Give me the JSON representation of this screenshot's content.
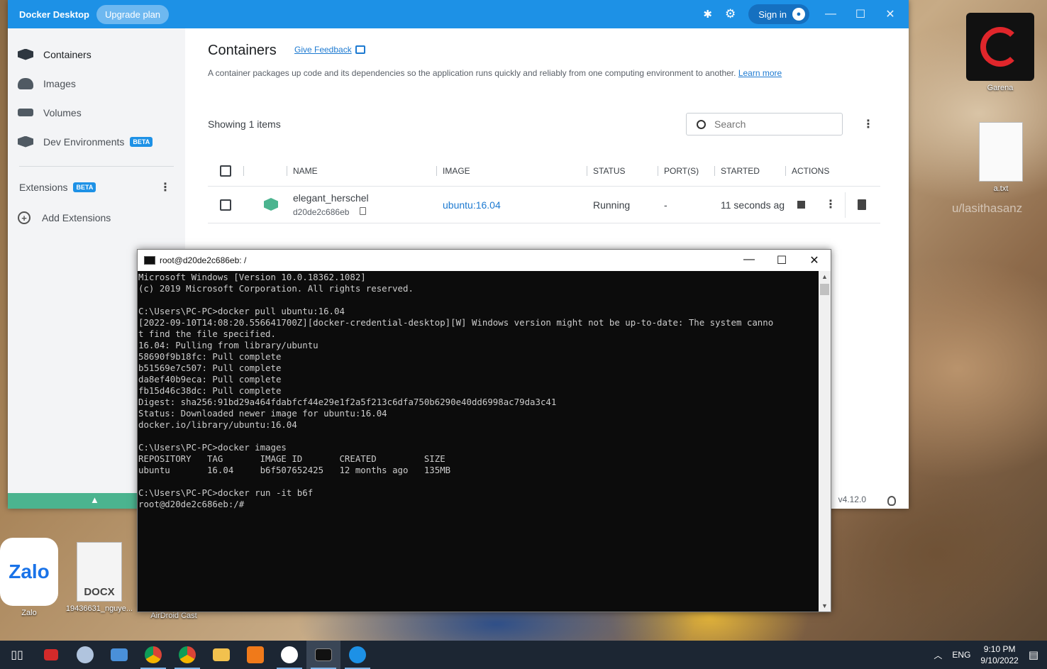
{
  "desktop": {
    "icons": [
      {
        "label": "Garena"
      },
      {
        "label": "a.txt"
      },
      {
        "label": "Zalo"
      },
      {
        "label": "19436631_nguye..."
      },
      {
        "label": "AirDroid Cast"
      }
    ],
    "watermark": "u/lasithasanz",
    "docx_tag": "DOCX",
    "zalo_logo": "Zalo"
  },
  "docker": {
    "app_title": "Docker Desktop",
    "upgrade_label": "Upgrade plan",
    "signin_label": "Sign in",
    "sidebar": {
      "items": [
        {
          "label": "Containers",
          "icon": "containers-icon"
        },
        {
          "label": "Images",
          "icon": "cloud-icon"
        },
        {
          "label": "Volumes",
          "icon": "volume-icon"
        },
        {
          "label": "Dev Environments",
          "icon": "dev-env-icon",
          "badge": "BETA"
        }
      ],
      "extensions_label": "Extensions",
      "extensions_badge": "BETA",
      "add_extensions_label": "Add Extensions"
    },
    "main": {
      "title": "Containers",
      "feedback_label": "Give Feedback",
      "description": "A container packages up code and its dependencies so the application runs quickly and reliably from one computing environment to another.",
      "learn_more": "Learn more",
      "showing": "Showing 1 items",
      "search_placeholder": "Search",
      "columns": [
        "NAME",
        "IMAGE",
        "STATUS",
        "PORT(S)",
        "STARTED",
        "ACTIONS"
      ],
      "rows": [
        {
          "name": "elegant_herschel",
          "id": "d20de2c686eb",
          "image": "ubuntu:16.04",
          "status": "Running",
          "ports": "-",
          "started": "11 seconds ag"
        }
      ]
    },
    "version": "v4.12.0"
  },
  "terminal": {
    "title": "root@d20de2c686eb: /",
    "lines": [
      "Microsoft Windows [Version 10.0.18362.1082]",
      "(c) 2019 Microsoft Corporation. All rights reserved.",
      "",
      "C:\\Users\\PC-PC>docker pull ubuntu:16.04",
      "[2022-09-10T14:08:20.556641700Z][docker-credential-desktop][W] Windows version might not be up-to-date: The system canno",
      "t find the file specified.",
      "16.04: Pulling from library/ubuntu",
      "58690f9b18fc: Pull complete",
      "b51569e7c507: Pull complete",
      "da8ef40b9eca: Pull complete",
      "fb15d46c38dc: Pull complete",
      "Digest: sha256:91bd29a464fdabfcf44e29e1f2a5f213c6dfa750b6290e40dd6998ac79da3c41",
      "Status: Downloaded newer image for ubuntu:16.04",
      "docker.io/library/ubuntu:16.04",
      "",
      "C:\\Users\\PC-PC>docker images",
      "REPOSITORY   TAG       IMAGE ID       CREATED         SIZE",
      "ubuntu       16.04     b6f507652425   12 months ago   135MB",
      "",
      "C:\\Users\\PC-PC>docker run -it b6f",
      "root@d20de2c686eb:/#"
    ]
  },
  "taskbar": {
    "language": "ENG",
    "time": "9:10 PM",
    "date": "9/10/2022"
  },
  "colors": {
    "docker_blue": "#1d91e6",
    "accent_green": "#4bb48f",
    "link": "#1d7ad1"
  }
}
